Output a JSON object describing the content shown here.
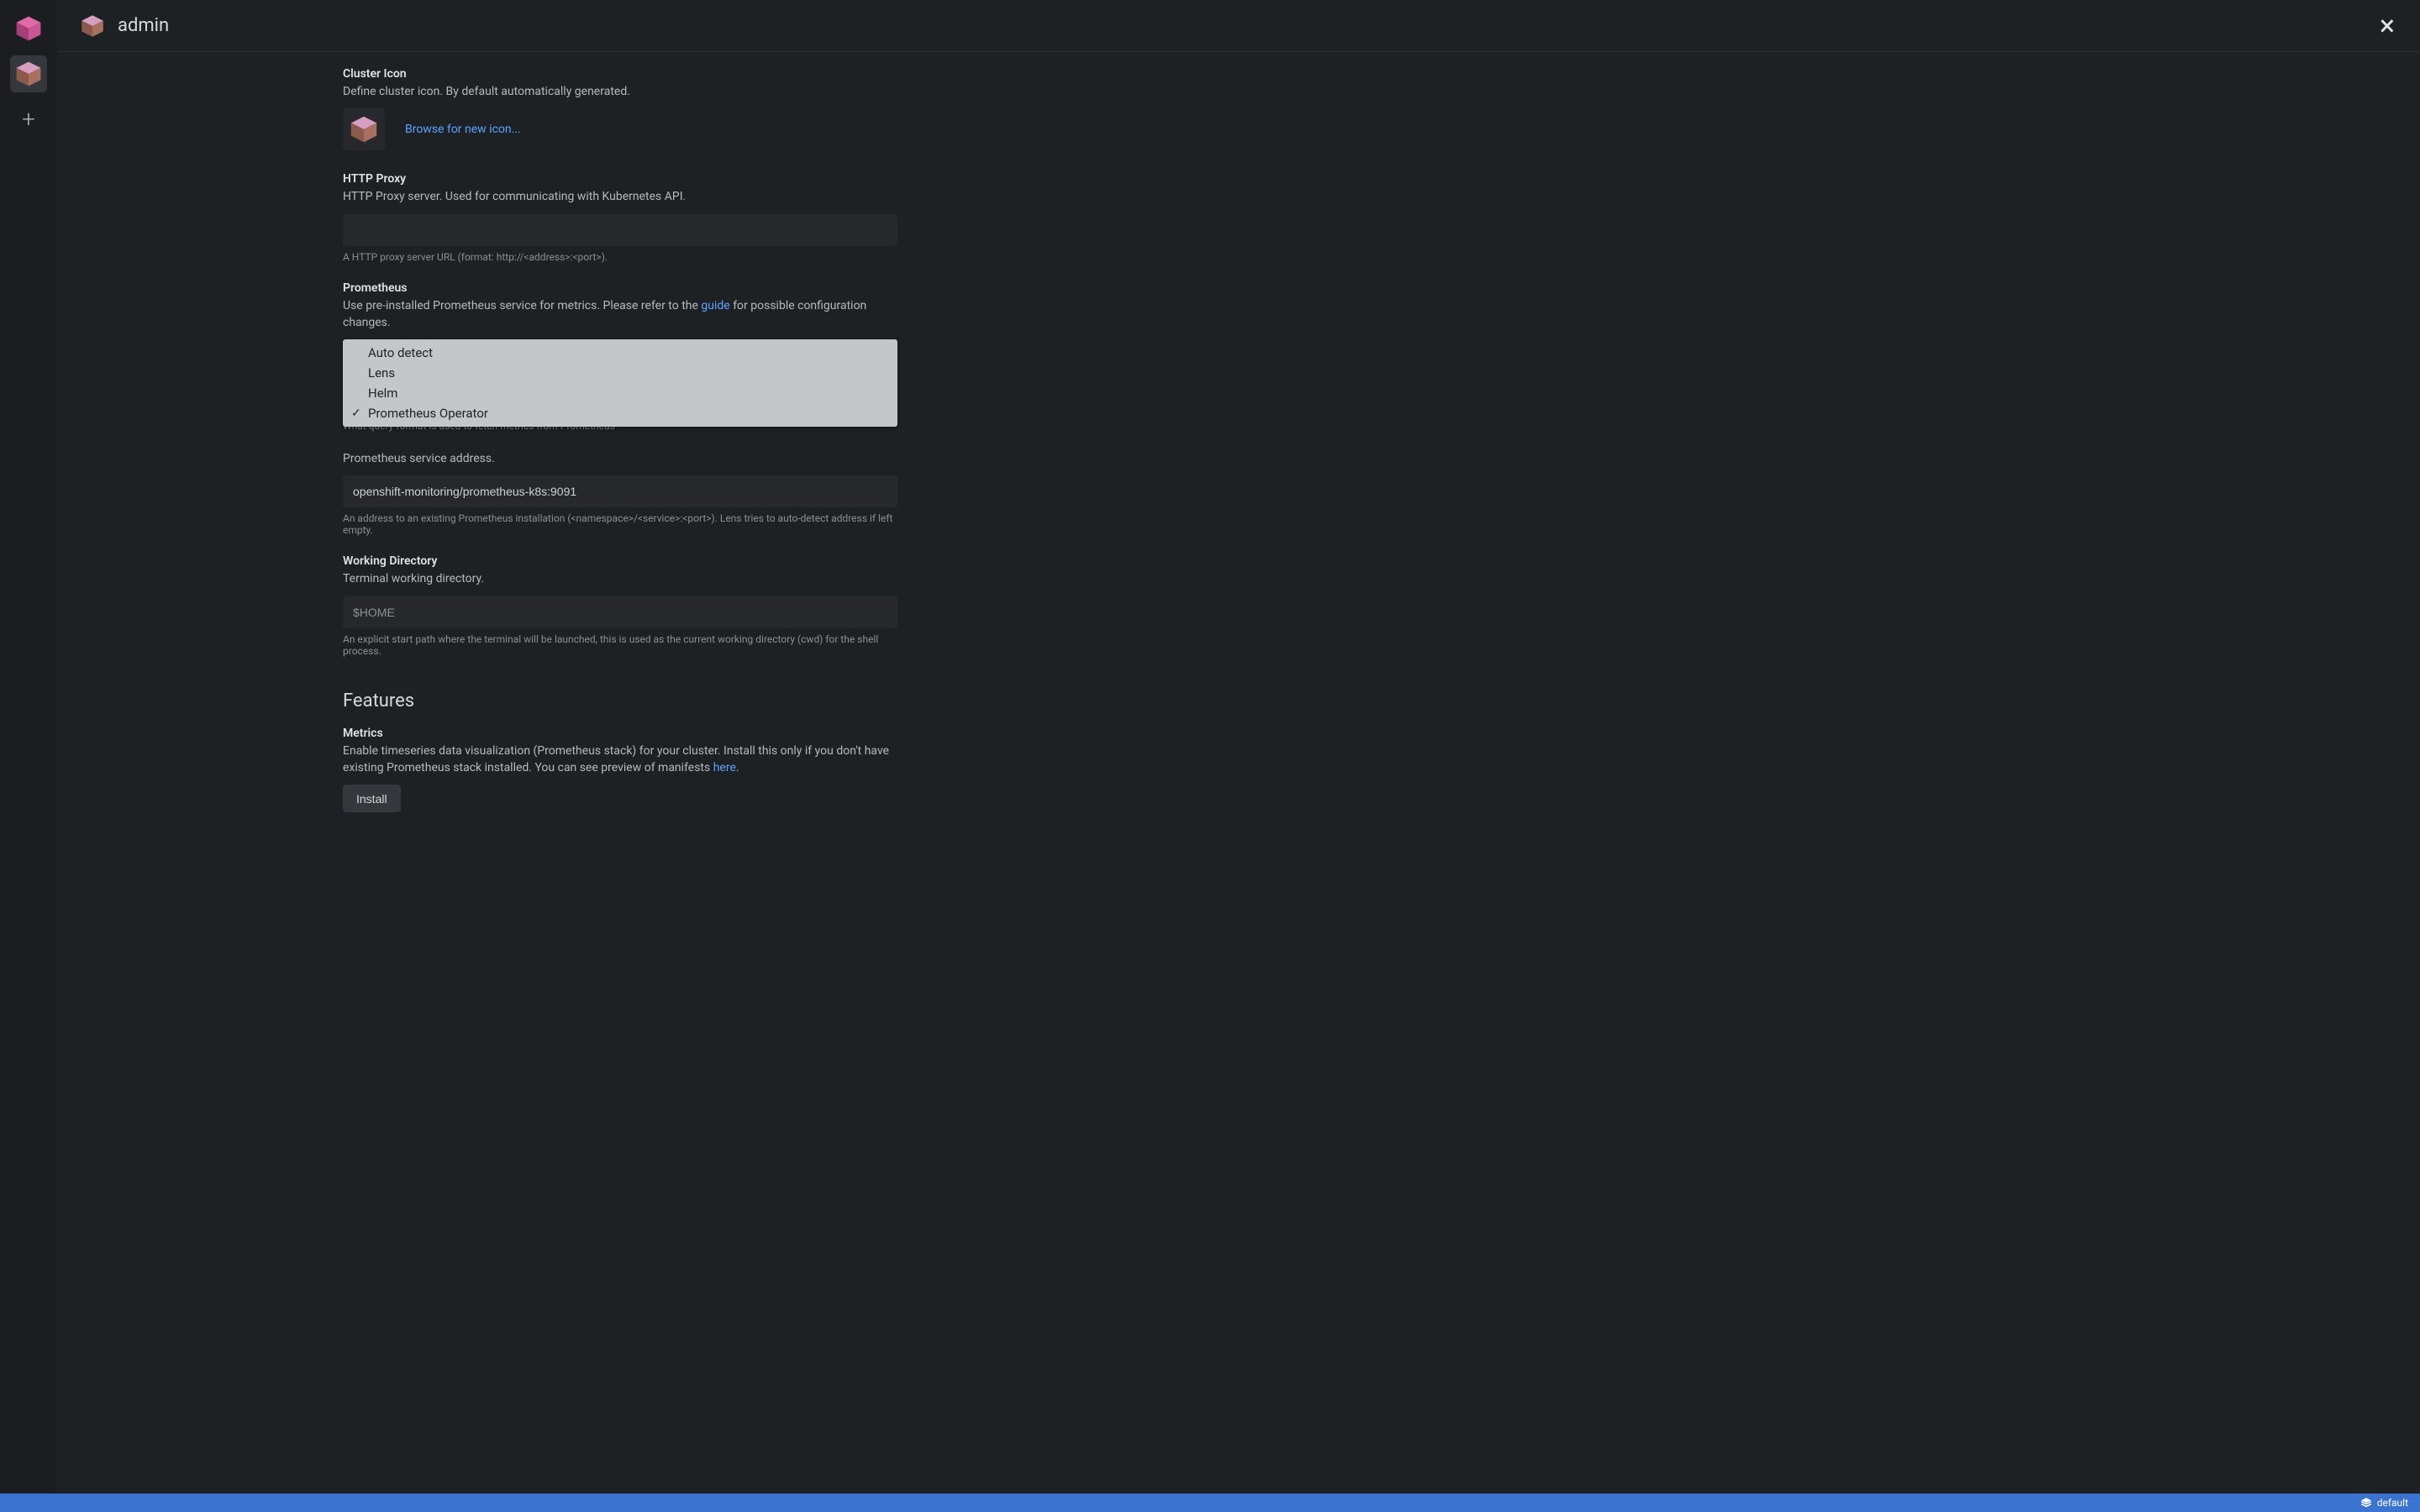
{
  "header": {
    "title": "admin"
  },
  "sections": {
    "clusterIcon": {
      "label": "Cluster Icon",
      "desc": "Define cluster icon. By default automatically generated.",
      "browse": "Browse for new icon..."
    },
    "httpProxy": {
      "label": "HTTP Proxy",
      "desc": "HTTP Proxy server. Used for communicating with Kubernetes API.",
      "hint": "A HTTP proxy server URL (format: http://<address>:<port>)."
    },
    "prometheus": {
      "label": "Prometheus",
      "desc_pre": "Use pre-installed Prometheus service for metrics. Please refer to the ",
      "desc_link": "guide",
      "desc_post": " for possible configuration changes.",
      "options": {
        "autoDetect": "Auto detect",
        "lens": "Lens",
        "helm": "Helm",
        "operator": "Prometheus Operator"
      },
      "query_hint": "What query format is used to fetch metrics from Prometheus",
      "addr_label": "Prometheus service address.",
      "addr_value": "openshift-monitoring/prometheus-k8s:9091",
      "addr_hint": "An address to an existing Prometheus installation (<namespace>/<service>:<port>). Lens tries to auto-detect address if left empty."
    },
    "workingDir": {
      "label": "Working Directory",
      "desc": "Terminal working directory.",
      "placeholder": "$HOME",
      "hint": "An explicit start path where the terminal will be launched, this is used as the current working directory (cwd) for the shell process."
    }
  },
  "features": {
    "heading": "Features",
    "metrics": {
      "label": "Metrics",
      "desc_pre": "Enable timeseries data visualization (Prometheus stack) for your cluster. Install this only if you don't have existing Prometheus stack installed. You can see preview of manifests ",
      "desc_link": "here",
      "desc_post": ".",
      "install": "Install"
    }
  },
  "status": {
    "context": "default"
  },
  "icons": {
    "cubePink": "cube-icon",
    "cubeBrown": "cube-icon",
    "plus": "plus-icon",
    "close": "close-icon",
    "layers": "layers-icon"
  }
}
